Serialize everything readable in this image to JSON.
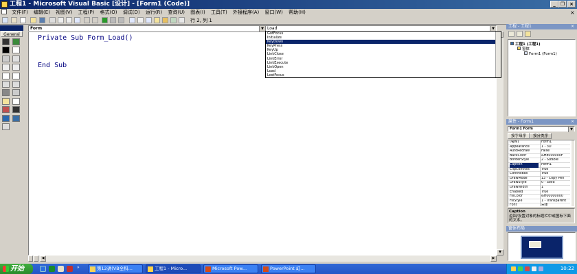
{
  "window": {
    "title": "工程1 - Microsoft Visual Basic [设计] - [Form1 (Code)]",
    "minimize_glyph": "_",
    "restore_glyph": "❐",
    "close_glyph": "×"
  },
  "menu": [
    "文件(F)",
    "编辑(E)",
    "视图(V)",
    "工程(P)",
    "格式(O)",
    "调试(D)",
    "运行(R)",
    "查询(U)",
    "图表(I)",
    "工具(T)",
    "外接程序(A)",
    "窗口(W)",
    "帮助(H)"
  ],
  "menu_close_glyph": "×",
  "toolbar": {
    "position_text": "行 2, 列 1"
  },
  "toolbox": {
    "tab_label": "General",
    "tools": [
      "pointer-icon",
      "picturebox-icon",
      "label-icon",
      "textbox-icon",
      "frame-icon",
      "commandbutton-icon",
      "checkbox-icon",
      "optionbutton-icon",
      "combobox-icon",
      "listbox-icon",
      "hscrollbar-icon",
      "vscrollbar-icon",
      "timer-icon",
      "drivelistbox-icon",
      "dirlistbox-icon",
      "filelistbox-icon",
      "shape-icon",
      "line-icon",
      "image-icon",
      "data-icon",
      "ole-icon"
    ]
  },
  "code_window": {
    "object_combo": "Form",
    "procedure_combo": "Load",
    "lines": [
      "Private Sub Form_Load()",
      "",
      "End Sub"
    ]
  },
  "procedure_list": {
    "items": [
      "GotFocus",
      "Initialize",
      "KeyDown",
      "KeyPress",
      "KeyUp",
      "LinkClose",
      "LinkError",
      "LinkExecute",
      "LinkOpen",
      "Load",
      "LostFocus",
      "MouseDown"
    ],
    "selected_index": 2
  },
  "project_panel": {
    "title": "工程 - 工程1",
    "tree": [
      {
        "label": "工程1 (工程1)",
        "level": 0,
        "icon": "project-icon"
      },
      {
        "label": "窗体",
        "level": 1,
        "icon": "folder-icon"
      },
      {
        "label": "Form1 (Form1)",
        "level": 2,
        "icon": "form-icon"
      }
    ]
  },
  "properties_panel": {
    "title": "属性 - Form1",
    "object": "Form1 Form",
    "tabs": [
      "按字母序",
      "按分类序"
    ],
    "active_tab": 0,
    "rows": [
      {
        "name": "(名称)",
        "value": "Form1"
      },
      {
        "name": "Appearance",
        "value": "1 - 3D"
      },
      {
        "name": "AutoRedraw",
        "value": "False"
      },
      {
        "name": "BackColor",
        "value": "&H8000000F"
      },
      {
        "name": "BorderStyle",
        "value": "2 - Sizable"
      },
      {
        "name": "Caption",
        "value": "Form1"
      },
      {
        "name": "ClipControls",
        "value": "True"
      },
      {
        "name": "ControlBox",
        "value": "True"
      },
      {
        "name": "DrawMode",
        "value": "13 - Copy Pen"
      },
      {
        "name": "DrawStyle",
        "value": "0 - Solid"
      },
      {
        "name": "DrawWidth",
        "value": "1"
      },
      {
        "name": "Enabled",
        "value": "True"
      },
      {
        "name": "FillColor",
        "value": "&H00000000"
      },
      {
        "name": "FillStyle",
        "value": "1 - Transparent"
      },
      {
        "name": "Font",
        "value": "宋体"
      }
    ],
    "selected_row": 5,
    "desc_title": "Caption",
    "desc_text": "返回/设置对象的标题栏中或图标下面的文本。"
  },
  "layout_panel": {
    "title": "窗体布局"
  },
  "taskbar": {
    "start_label": "开始",
    "tasks": [
      {
        "label": "第12讲(VB全科...",
        "icon": "folder-icon"
      },
      {
        "label": "工程1 - Micro...",
        "icon": "vb-icon",
        "active": true
      },
      {
        "label": "Microsoft Pow...",
        "icon": "ppt-icon"
      },
      {
        "label": "PowerPoint 幻...",
        "icon": "ppt-icon"
      }
    ],
    "clock": "10:22"
  },
  "colors": {
    "title_bar": "#0a246a",
    "selection": "#0a246a",
    "code_text": "#000080",
    "taskbar": "#2456c7",
    "start": "#2b8a2b"
  }
}
